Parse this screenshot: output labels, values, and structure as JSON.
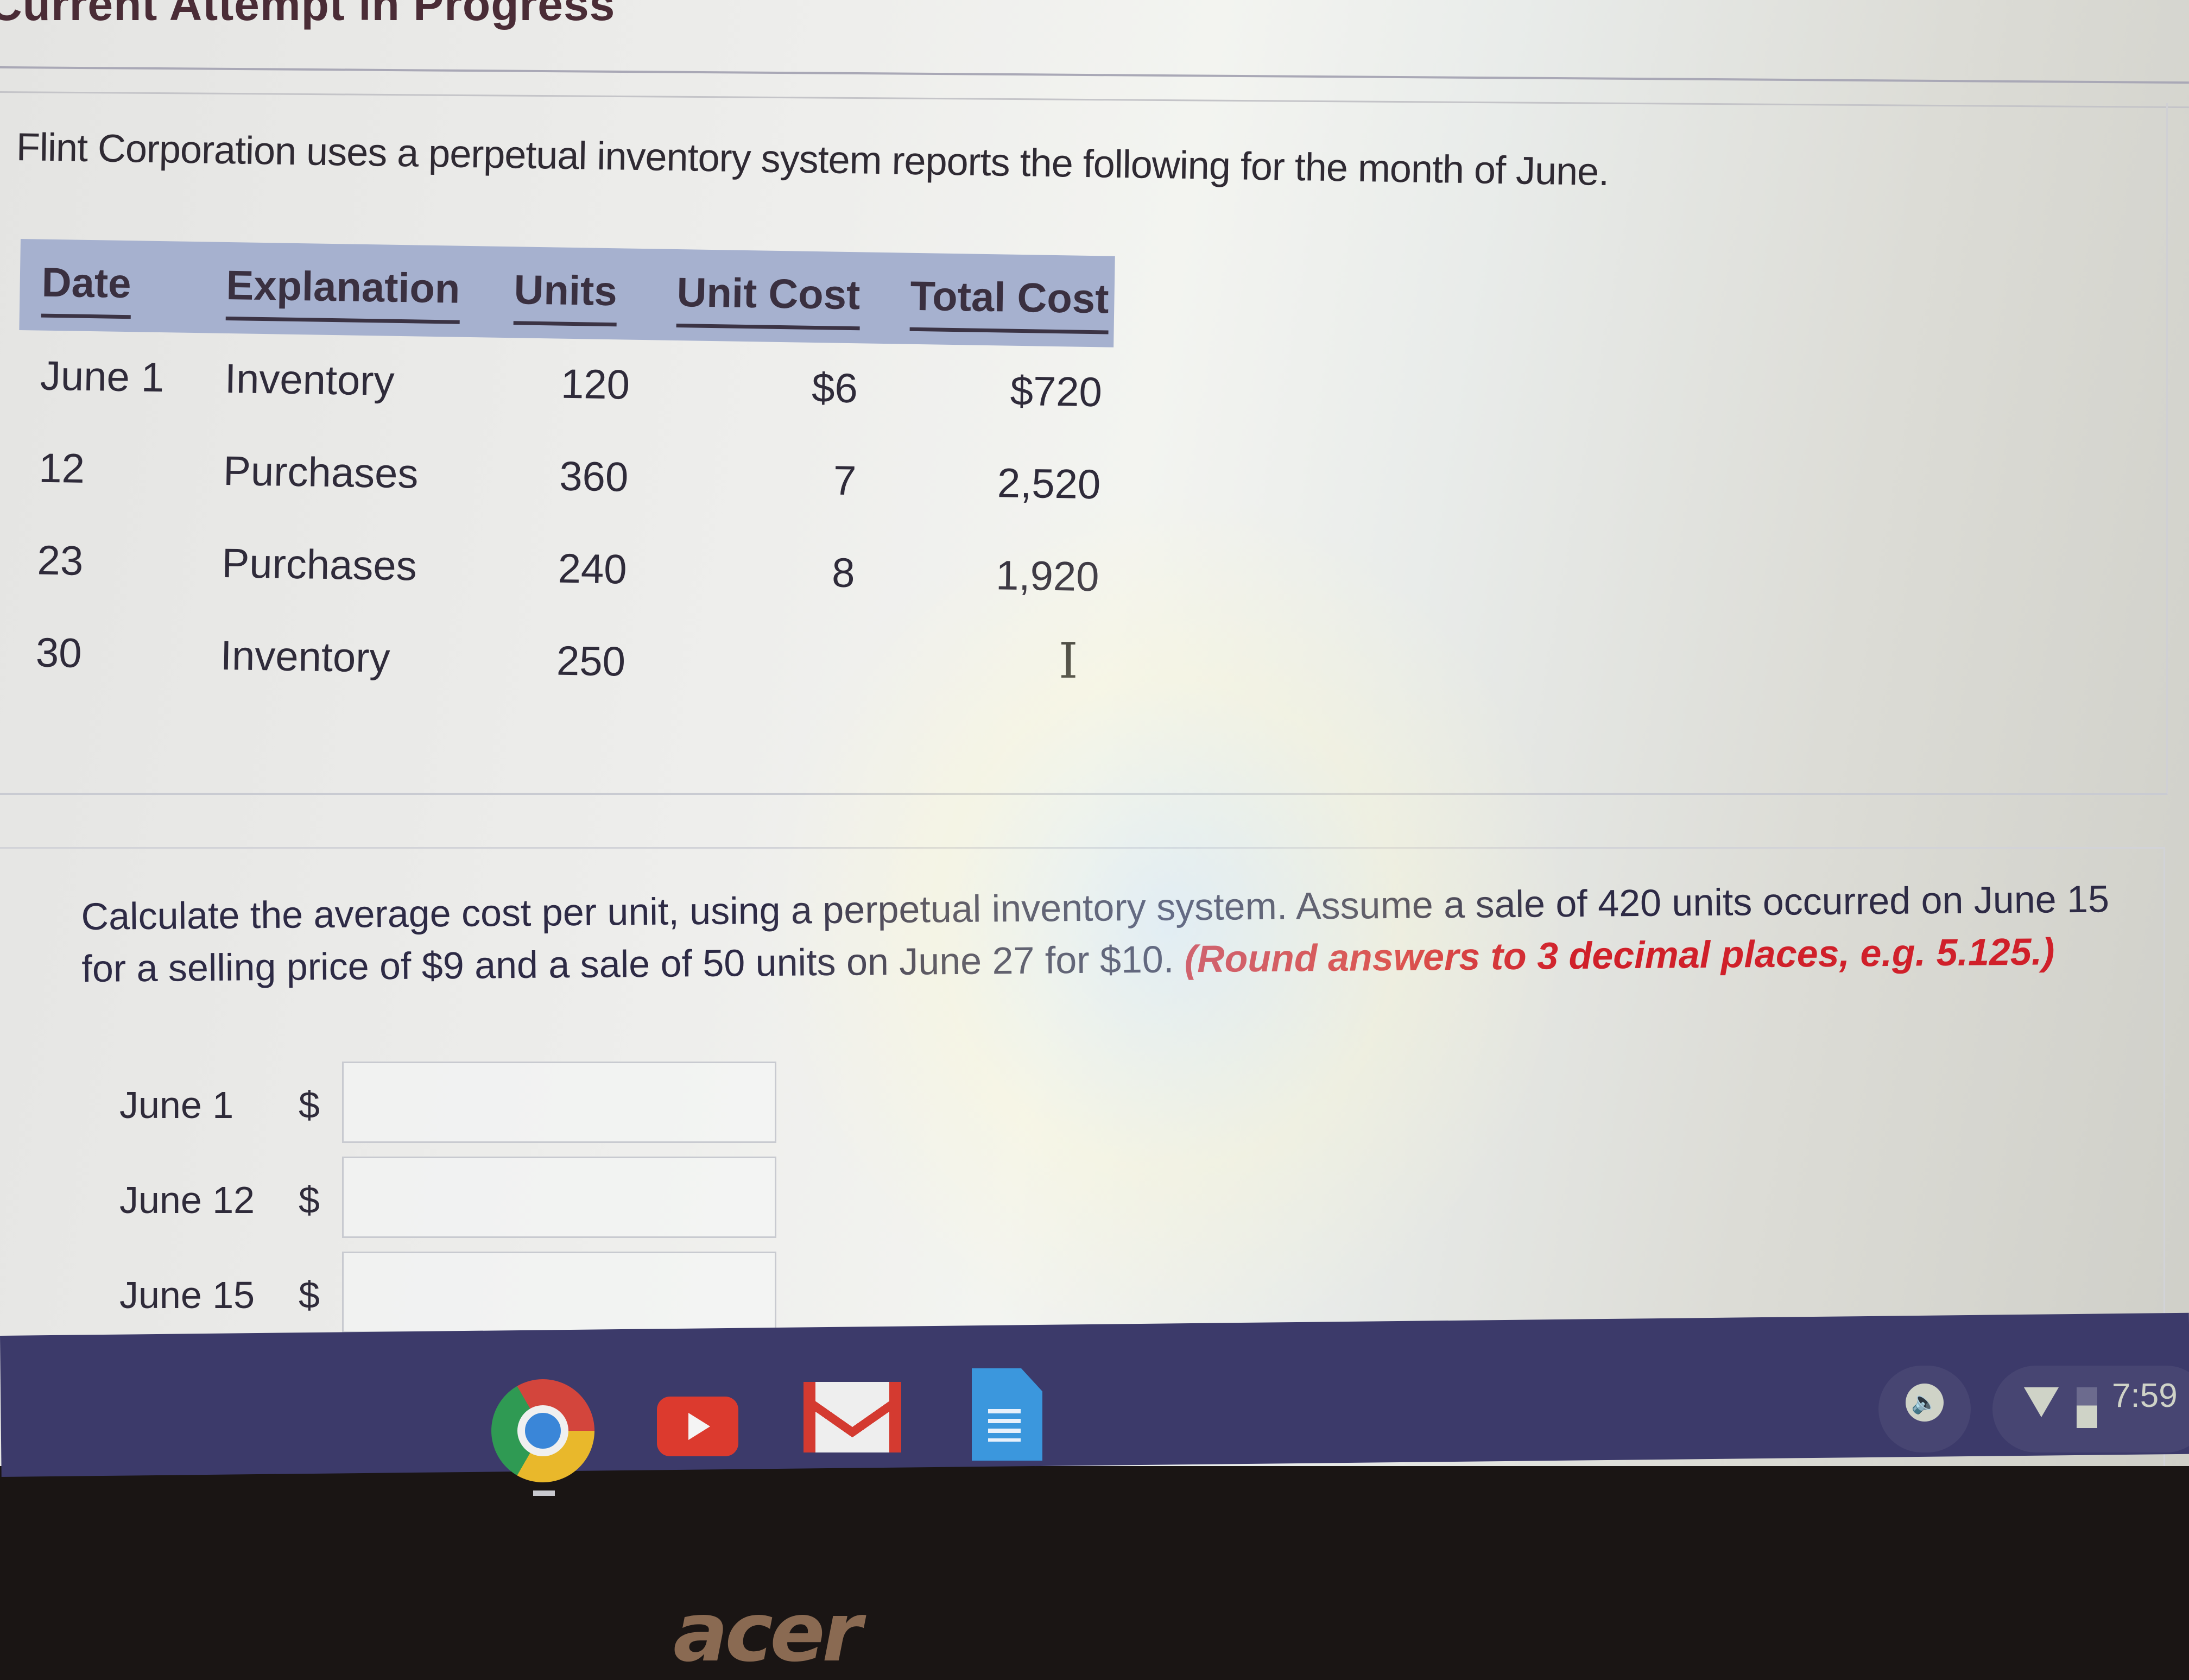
{
  "header": {
    "attempt_status": "Current Attempt in Progress"
  },
  "question": {
    "intro": "Flint Corporation uses a perpetual inventory system reports the following for the month of June.",
    "table": {
      "columns": [
        "Date",
        "Explanation",
        "Units",
        "Unit Cost",
        "Total Cost"
      ],
      "rows": [
        {
          "date": "June 1",
          "explanation": "Inventory",
          "units": "120",
          "unit_cost": "$6",
          "total_cost": "$720"
        },
        {
          "date": "12",
          "explanation": "Purchases",
          "units": "360",
          "unit_cost": "7",
          "total_cost": "2,520"
        },
        {
          "date": "23",
          "explanation": "Purchases",
          "units": "240",
          "unit_cost": "8",
          "total_cost": "1,920"
        },
        {
          "date": "30",
          "explanation": "Inventory",
          "units": "250",
          "unit_cost": "",
          "total_cost": ""
        }
      ]
    }
  },
  "task": {
    "instruction": "Calculate the average cost per unit, using a perpetual inventory system. Assume a sale of 420 units occurred on June 15 for a selling price of $9 and a sale of 50 units on June 27 for $10.",
    "rounding_note": "(Round answers to 3 decimal places, e.g. 5.125.)",
    "answers": [
      {
        "label": "June 1",
        "currency": "$",
        "value": ""
      },
      {
        "label": "June 12",
        "currency": "$",
        "value": ""
      },
      {
        "label": "June 15",
        "currency": "$",
        "value": ""
      }
    ]
  },
  "shelf": {
    "apps": [
      "chrome",
      "youtube",
      "gmail",
      "docs"
    ],
    "volume_glyph": "🔈",
    "clock": "7:59"
  },
  "bezel": {
    "brand": "acer"
  }
}
